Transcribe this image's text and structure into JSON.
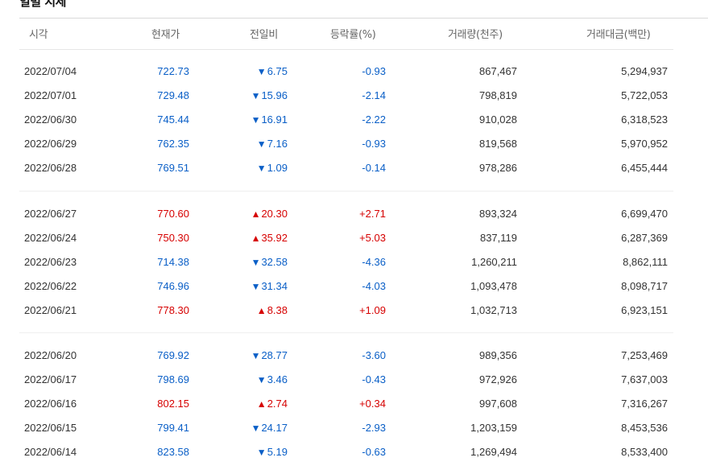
{
  "title": "일별 시세",
  "headers": {
    "date": "시각",
    "price": "현재가",
    "change": "전일비",
    "rate": "등락률(%)",
    "volume": "거래량(천주)",
    "amount": "거래대금(백만)"
  },
  "colors": {
    "up": "#d60000",
    "down": "#0a5fc7"
  },
  "icons": {
    "up": "triangle-up-icon",
    "down": "triangle-down-icon"
  },
  "rows": [
    {
      "date": "2022/07/04",
      "price": "722.73",
      "dir": "down",
      "arrow": "▼",
      "change": "6.75",
      "rate": "-0.93",
      "volume": "867,467",
      "amount": "5,294,937"
    },
    {
      "date": "2022/07/01",
      "price": "729.48",
      "dir": "down",
      "arrow": "▼",
      "change": "15.96",
      "rate": "-2.14",
      "volume": "798,819",
      "amount": "5,722,053"
    },
    {
      "date": "2022/06/30",
      "price": "745.44",
      "dir": "down",
      "arrow": "▼",
      "change": "16.91",
      "rate": "-2.22",
      "volume": "910,028",
      "amount": "6,318,523"
    },
    {
      "date": "2022/06/29",
      "price": "762.35",
      "dir": "down",
      "arrow": "▼",
      "change": "7.16",
      "rate": "-0.93",
      "volume": "819,568",
      "amount": "5,970,952"
    },
    {
      "date": "2022/06/28",
      "price": "769.51",
      "dir": "down",
      "arrow": "▼",
      "change": "1.09",
      "rate": "-0.14",
      "volume": "978,286",
      "amount": "6,455,444"
    },
    {
      "date": "2022/06/27",
      "price": "770.60",
      "dir": "up",
      "arrow": "▲",
      "change": "20.30",
      "rate": "+2.71",
      "volume": "893,324",
      "amount": "6,699,470"
    },
    {
      "date": "2022/06/24",
      "price": "750.30",
      "dir": "up",
      "arrow": "▲",
      "change": "35.92",
      "rate": "+5.03",
      "volume": "837,119",
      "amount": "6,287,369"
    },
    {
      "date": "2022/06/23",
      "price": "714.38",
      "dir": "down",
      "arrow": "▼",
      "change": "32.58",
      "rate": "-4.36",
      "volume": "1,260,211",
      "amount": "8,862,111"
    },
    {
      "date": "2022/06/22",
      "price": "746.96",
      "dir": "down",
      "arrow": "▼",
      "change": "31.34",
      "rate": "-4.03",
      "volume": "1,093,478",
      "amount": "8,098,717"
    },
    {
      "date": "2022/06/21",
      "price": "778.30",
      "dir": "up",
      "arrow": "▲",
      "change": "8.38",
      "rate": "+1.09",
      "volume": "1,032,713",
      "amount": "6,923,151"
    },
    {
      "date": "2022/06/20",
      "price": "769.92",
      "dir": "down",
      "arrow": "▼",
      "change": "28.77",
      "rate": "-3.60",
      "volume": "989,356",
      "amount": "7,253,469"
    },
    {
      "date": "2022/06/17",
      "price": "798.69",
      "dir": "down",
      "arrow": "▼",
      "change": "3.46",
      "rate": "-0.43",
      "volume": "972,926",
      "amount": "7,637,003"
    },
    {
      "date": "2022/06/16",
      "price": "802.15",
      "dir": "up",
      "arrow": "▲",
      "change": "2.74",
      "rate": "+0.34",
      "volume": "997,608",
      "amount": "7,316,267"
    },
    {
      "date": "2022/06/15",
      "price": "799.41",
      "dir": "down",
      "arrow": "▼",
      "change": "24.17",
      "rate": "-2.93",
      "volume": "1,203,159",
      "amount": "8,453,536"
    },
    {
      "date": "2022/06/14",
      "price": "823.58",
      "dir": "down",
      "arrow": "▼",
      "change": "5.19",
      "rate": "-0.63",
      "volume": "1,269,494",
      "amount": "8,533,400"
    }
  ]
}
